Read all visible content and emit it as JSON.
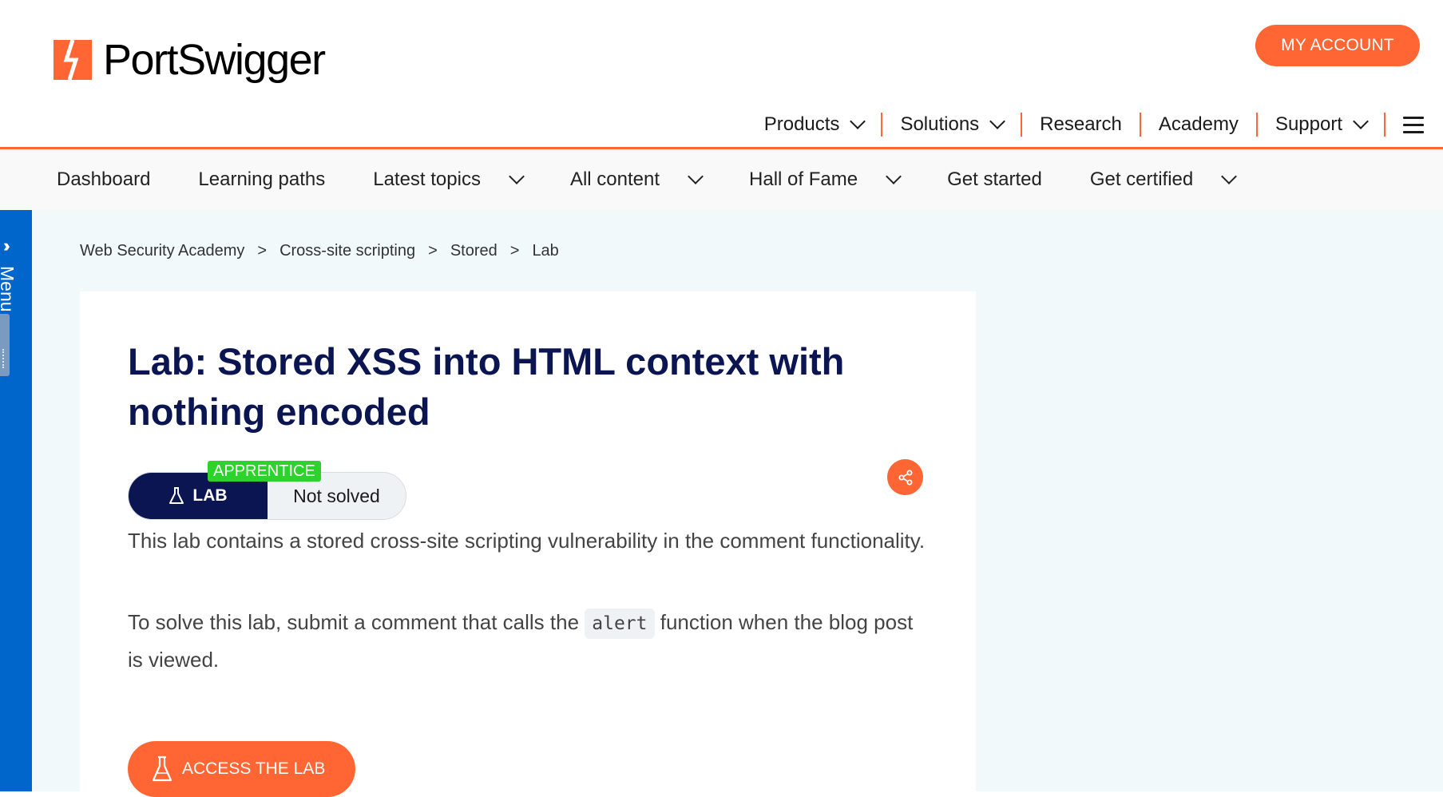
{
  "header": {
    "logo_text": "PortSwigger",
    "my_account_label": "MY ACCOUNT",
    "nav": [
      {
        "label": "Products"
      },
      {
        "label": "Solutions"
      },
      {
        "label": "Research"
      },
      {
        "label": "Academy"
      },
      {
        "label": "Support"
      }
    ]
  },
  "subnav": [
    {
      "label": "Dashboard"
    },
    {
      "label": "Learning paths"
    },
    {
      "label": "Latest topics"
    },
    {
      "label": "All content"
    },
    {
      "label": "Hall of Fame"
    },
    {
      "label": "Get started"
    },
    {
      "label": "Get certified"
    }
  ],
  "side_menu": {
    "label": "Menu"
  },
  "breadcrumb": [
    {
      "label": "Web Security Academy"
    },
    {
      "label": "Cross-site scripting"
    },
    {
      "label": "Stored"
    },
    {
      "label": "Lab"
    }
  ],
  "lab": {
    "title": "Lab: Stored XSS into HTML context with nothing encoded",
    "level": "APPRENTICE",
    "lab_label": "LAB",
    "status": "Not solved",
    "description_1": "This lab contains a stored cross-site scripting vulnerability in the comment functionality.",
    "description_2_before": "To solve this lab, submit a comment that calls the ",
    "description_2_code": "alert",
    "description_2_after": " function when the blog post is viewed.",
    "access_button": "ACCESS THE LAB"
  },
  "colors": {
    "brand_orange": "#ff6633",
    "navy": "#0a1551",
    "menu_blue": "#0066cc",
    "level_green": "#2bd32b",
    "page_bg": "#f2f9fa"
  },
  "icons": [
    "portswigger-logo-icon",
    "chevron-down-icon",
    "hamburger-icon",
    "double-chevron-right-icon",
    "flask-icon",
    "share-icon"
  ]
}
